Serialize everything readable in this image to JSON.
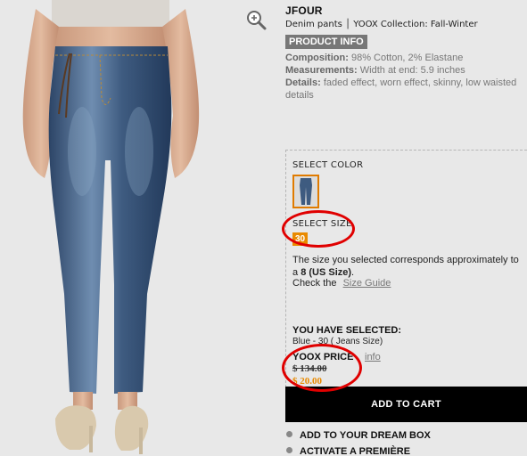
{
  "product": {
    "brand": "JFOUR",
    "subtitle": "Denim pants │ YOOX Collection: Fall-Winter",
    "badge": "PRODUCT INFO",
    "composition_label": "Composition:",
    "composition": "98% Cotton, 2% Elastane",
    "measurements_label": "Measurements:",
    "measurements": "Width at end: 5.9 inches",
    "details_label": "Details:",
    "details": "faded effect, worn effect, skinny, low waisted",
    "details_cont": "details"
  },
  "selector": {
    "color_label": "SELECT COLOR",
    "size_label": "SELECT SIZE",
    "size_value": "30",
    "size_note_1": "The size you selected corresponds approximately to",
    "size_note_2a": "a ",
    "size_note_2b": "8 (US Size)",
    "size_note_2c": ".",
    "guide_prefix": "Check the",
    "guide_link": "Size Guide",
    "selected_title": "YOU HAVE SELECTED:",
    "selected_value": "Blue - 30 ( Jeans Size)",
    "price_title": "YOOX PRICE",
    "price_info": "info",
    "price_old": "$ 134.00",
    "price_new": "$ 20.00"
  },
  "actions": {
    "add_to_cart": "ADD TO CART",
    "dream_box": "ADD TO YOUR DREAM BOX",
    "premiere": "ACTIVATE A PREMIÈRE"
  },
  "colors": {
    "accent": "#e98a00",
    "annotation": "#e00000",
    "button": "#000000",
    "background": "#e8e8e8"
  },
  "icons": {
    "zoom": "zoom-in-icon"
  }
}
